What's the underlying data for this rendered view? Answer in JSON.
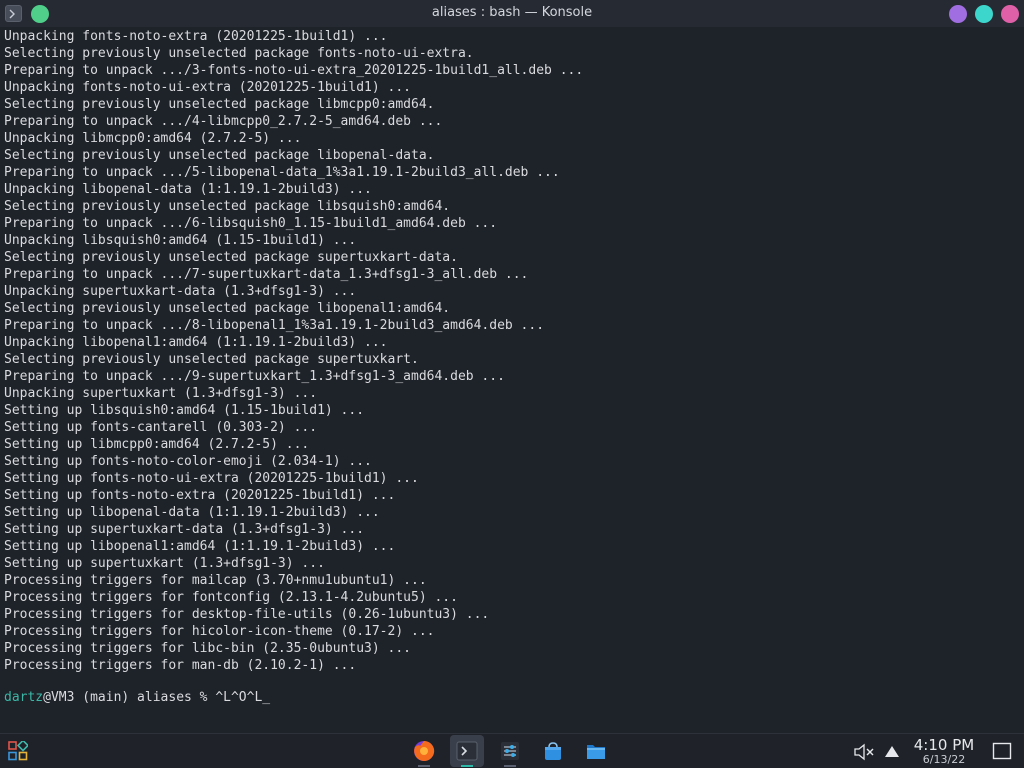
{
  "window": {
    "title": "aliases : bash — Konsole",
    "colors": {
      "close": "#4fcf8a",
      "btn1": "#a06ee0",
      "btn2": "#3dd6cc",
      "btn3": "#e060a8"
    },
    "icon": "terminal-icon"
  },
  "terminal": {
    "lines": [
      "Unpacking fonts-noto-extra (20201225-1build1) ...",
      "Selecting previously unselected package fonts-noto-ui-extra.",
      "Preparing to unpack .../3-fonts-noto-ui-extra_20201225-1build1_all.deb ...",
      "Unpacking fonts-noto-ui-extra (20201225-1build1) ...",
      "Selecting previously unselected package libmcpp0:amd64.",
      "Preparing to unpack .../4-libmcpp0_2.7.2-5_amd64.deb ...",
      "Unpacking libmcpp0:amd64 (2.7.2-5) ...",
      "Selecting previously unselected package libopenal-data.",
      "Preparing to unpack .../5-libopenal-data_1%3a1.19.1-2build3_all.deb ...",
      "Unpacking libopenal-data (1:1.19.1-2build3) ...",
      "Selecting previously unselected package libsquish0:amd64.",
      "Preparing to unpack .../6-libsquish0_1.15-1build1_amd64.deb ...",
      "Unpacking libsquish0:amd64 (1.15-1build1) ...",
      "Selecting previously unselected package supertuxkart-data.",
      "Preparing to unpack .../7-supertuxkart-data_1.3+dfsg1-3_all.deb ...",
      "Unpacking supertuxkart-data (1.3+dfsg1-3) ...",
      "Selecting previously unselected package libopenal1:amd64.",
      "Preparing to unpack .../8-libopenal1_1%3a1.19.1-2build3_amd64.deb ...",
      "Unpacking libopenal1:amd64 (1:1.19.1-2build3) ...",
      "Selecting previously unselected package supertuxkart.",
      "Preparing to unpack .../9-supertuxkart_1.3+dfsg1-3_amd64.deb ...",
      "Unpacking supertuxkart (1.3+dfsg1-3) ...",
      "Setting up libsquish0:amd64 (1.15-1build1) ...",
      "Setting up fonts-cantarell (0.303-2) ...",
      "Setting up libmcpp0:amd64 (2.7.2-5) ...",
      "Setting up fonts-noto-color-emoji (2.034-1) ...",
      "Setting up fonts-noto-ui-extra (20201225-1build1) ...",
      "Setting up fonts-noto-extra (20201225-1build1) ...",
      "Setting up libopenal-data (1:1.19.1-2build3) ...",
      "Setting up supertuxkart-data (1.3+dfsg1-3) ...",
      "Setting up libopenal1:amd64 (1:1.19.1-2build3) ...",
      "Setting up supertuxkart (1.3+dfsg1-3) ...",
      "Processing triggers for mailcap (3.70+nmu1ubuntu1) ...",
      "Processing triggers for fontconfig (2.13.1-4.2ubuntu5) ...",
      "Processing triggers for desktop-file-utils (0.26-1ubuntu3) ...",
      "Processing triggers for hicolor-icon-theme (0.17-2) ...",
      "Processing triggers for libc-bin (2.35-0ubuntu3) ...",
      "Processing triggers for man-db (2.10.2-1) ..."
    ],
    "prompt": {
      "user": "dartz",
      "rest": "@VM3 (main) aliases % ",
      "input": "^L^O^L",
      "cursor": "_"
    },
    "colors": {
      "text": "#d9dbde",
      "user": "#3cb7a6",
      "background": "#1e2229"
    }
  },
  "taskbar": {
    "launcher_icon": "app-grid-icon",
    "tasks": [
      {
        "icon": "firefox-icon",
        "active": false
      },
      {
        "icon": "konsole-icon",
        "active": true
      },
      {
        "icon": "system-settings-icon",
        "active": false
      },
      {
        "icon": "discover-store-icon",
        "active": false
      },
      {
        "icon": "dolphin-folder-icon",
        "active": false
      }
    ],
    "tray": {
      "volume_icon": "volume-muted-icon",
      "notifications_icon": "arrow-up-icon",
      "desktop_icon": "show-desktop-icon"
    },
    "clock": {
      "time": "4:10 PM",
      "date": "6/13/22"
    }
  }
}
